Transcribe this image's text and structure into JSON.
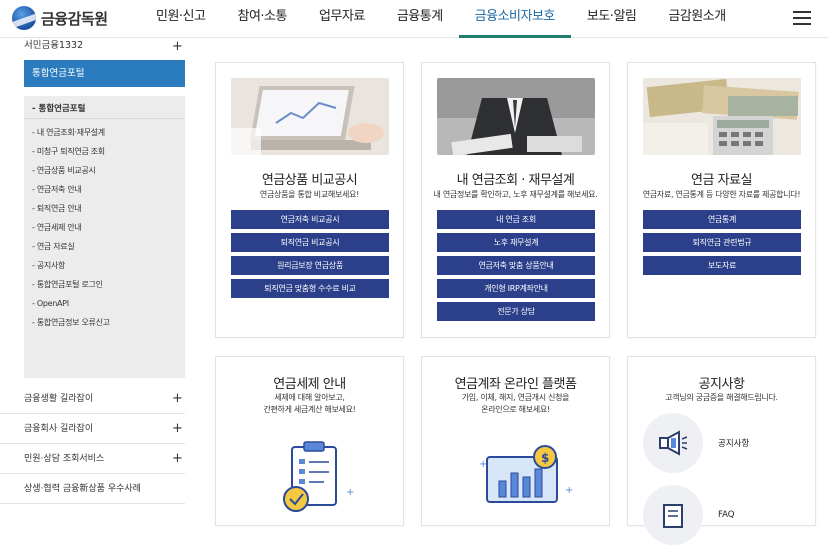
{
  "header": {
    "logo_text": "금융감독원",
    "nav": [
      "민원·신고",
      "참여·소통",
      "업무자료",
      "금융통계",
      "금융소비자보호",
      "보도·알림",
      "금감원소개"
    ],
    "active_index": 4
  },
  "sidebar": {
    "top_item": "서민금융1332",
    "active_item": "통합연금포털",
    "sub_head": "통합연금포털",
    "sub_items": [
      "내 연금조회·재무설계",
      "미청구 퇴직연금 조회",
      "연금상품 비교공시",
      "연금저축 안내",
      "퇴직연금 안내",
      "연금세제 안내",
      "연금 자료실",
      "공지사항",
      "통합연금포털 로그인",
      "OpenAPI",
      "통합연금정보 오류신고"
    ],
    "sections": [
      "금융생활 길라잡이",
      "금융회사 길라잡이",
      "민원·상담 조회서비스",
      "상생·협력 금융新상품 우수사례"
    ]
  },
  "cards": {
    "c1": {
      "title": "연금상품 비교공시",
      "desc": "연금상품을 통합 비교해보세요!",
      "buttons": [
        "연금저축 비교공시",
        "퇴직연금 비교공시",
        "원리금보장 연금상품",
        "퇴직연금 맞춤형 수수료 비교"
      ]
    },
    "c2": {
      "title": "내 연금조회 · 재무설계",
      "desc": "내 연금정보를 확인하고, 노후 재무설계를 해보세요.",
      "buttons": [
        "내 연금 조회",
        "노후 재무설계",
        "연금저축 맞춤 상품안내",
        "개인형 IRP계좌안내",
        "전문가 상담"
      ]
    },
    "c3": {
      "title": "연금 자료실",
      "desc": "연금자료, 연금통계 등 다양한 자료를 제공합니다!",
      "buttons": [
        "연금통계",
        "퇴직연금 관련법규",
        "보도자료"
      ]
    },
    "c4": {
      "title": "연금세제 안내",
      "desc1": "세제에 대해 알아보고,",
      "desc2": "간편하게 세금계산 해보세요!"
    },
    "c5": {
      "title": "연금계좌 온라인 플랫폼",
      "desc1": "가입, 이체, 해지, 연금개시 신청을",
      "desc2": "온라인으로 해보세요!"
    },
    "c6": {
      "title": "공지사항",
      "desc": "고객님의 궁금증을 해결해드립니다.",
      "items": [
        "공지사항",
        "FAQ"
      ]
    }
  },
  "colors": {
    "button": "#2c3f8a",
    "active_side": "#2b7bbf",
    "active_nav": "#1b6aa6"
  }
}
